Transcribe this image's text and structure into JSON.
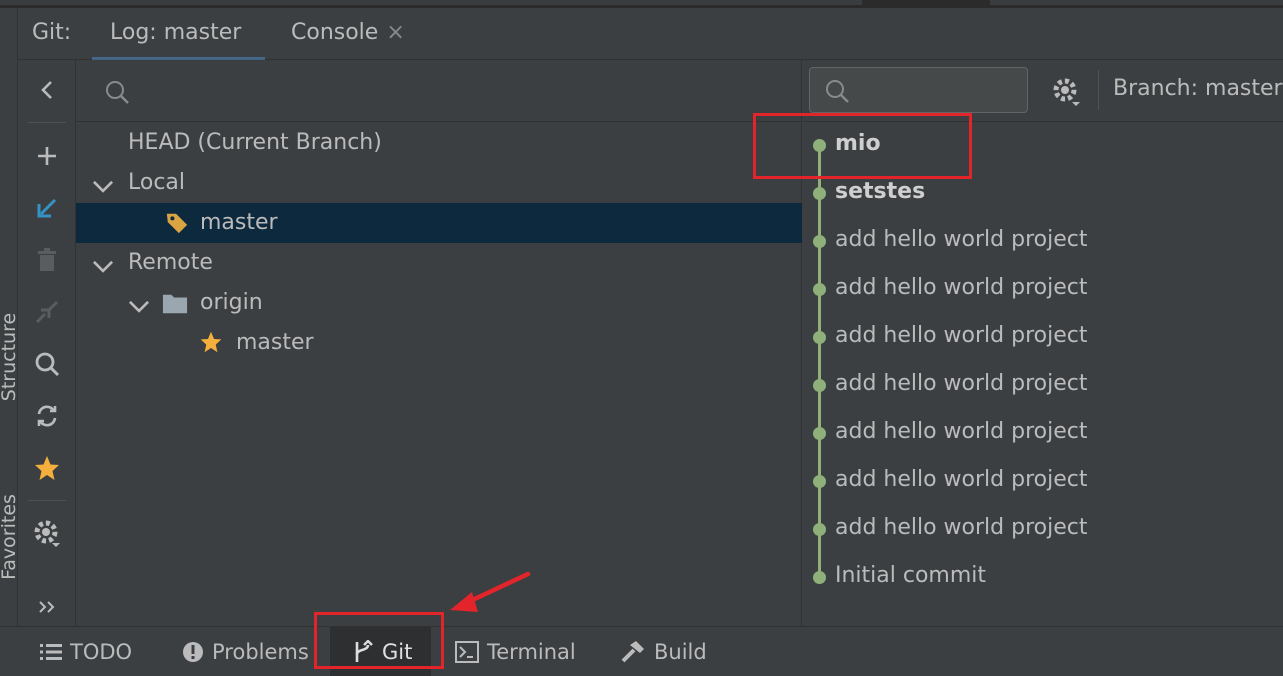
{
  "header": {
    "prefix": "Git:",
    "tabs": [
      {
        "label": "Log: master",
        "active": true
      },
      {
        "label": "Console",
        "active": false,
        "closable": true
      }
    ]
  },
  "left_strip": {
    "labels": [
      "Structure",
      "Favorites"
    ]
  },
  "toolbar": {
    "icons": [
      "collapse-left-icon",
      "add-icon",
      "checkout-icon",
      "delete-icon",
      "merge-icon",
      "search-icon",
      "refresh-icon",
      "star-icon",
      "gear-icon",
      "more-icon"
    ]
  },
  "branches": {
    "search_placeholder": "",
    "head": "HEAD (Current Branch)",
    "local_label": "Local",
    "local_branches": [
      "master"
    ],
    "remote_label": "Remote",
    "remote_name": "origin",
    "remote_branches": [
      "master"
    ]
  },
  "log": {
    "search_placeholder": "",
    "branch_filter": "Branch: master",
    "commits": [
      {
        "message": "mio",
        "bold": true
      },
      {
        "message": "setstes",
        "bold": true
      },
      {
        "message": "add hello world project",
        "bold": false
      },
      {
        "message": "add hello world project",
        "bold": false
      },
      {
        "message": "add hello world project",
        "bold": false
      },
      {
        "message": "add hello world project",
        "bold": false
      },
      {
        "message": "add hello world project",
        "bold": false
      },
      {
        "message": "add hello world project",
        "bold": false
      },
      {
        "message": "add hello world project",
        "bold": false
      },
      {
        "message": "Initial commit",
        "bold": false
      }
    ]
  },
  "bottom_bar": {
    "items": [
      {
        "label": "TODO",
        "icon": "list-icon"
      },
      {
        "label": "Problems",
        "icon": "problems-icon"
      },
      {
        "label": "Git",
        "icon": "git-branch-icon",
        "active": true
      },
      {
        "label": "Terminal",
        "icon": "terminal-icon"
      },
      {
        "label": "Build",
        "icon": "hammer-icon"
      }
    ]
  },
  "colors": {
    "background": "#3c3f41",
    "selection": "#0d293e",
    "graph": "#8fb07a",
    "annotation": "#e3242b",
    "star": "#f4af3d"
  }
}
